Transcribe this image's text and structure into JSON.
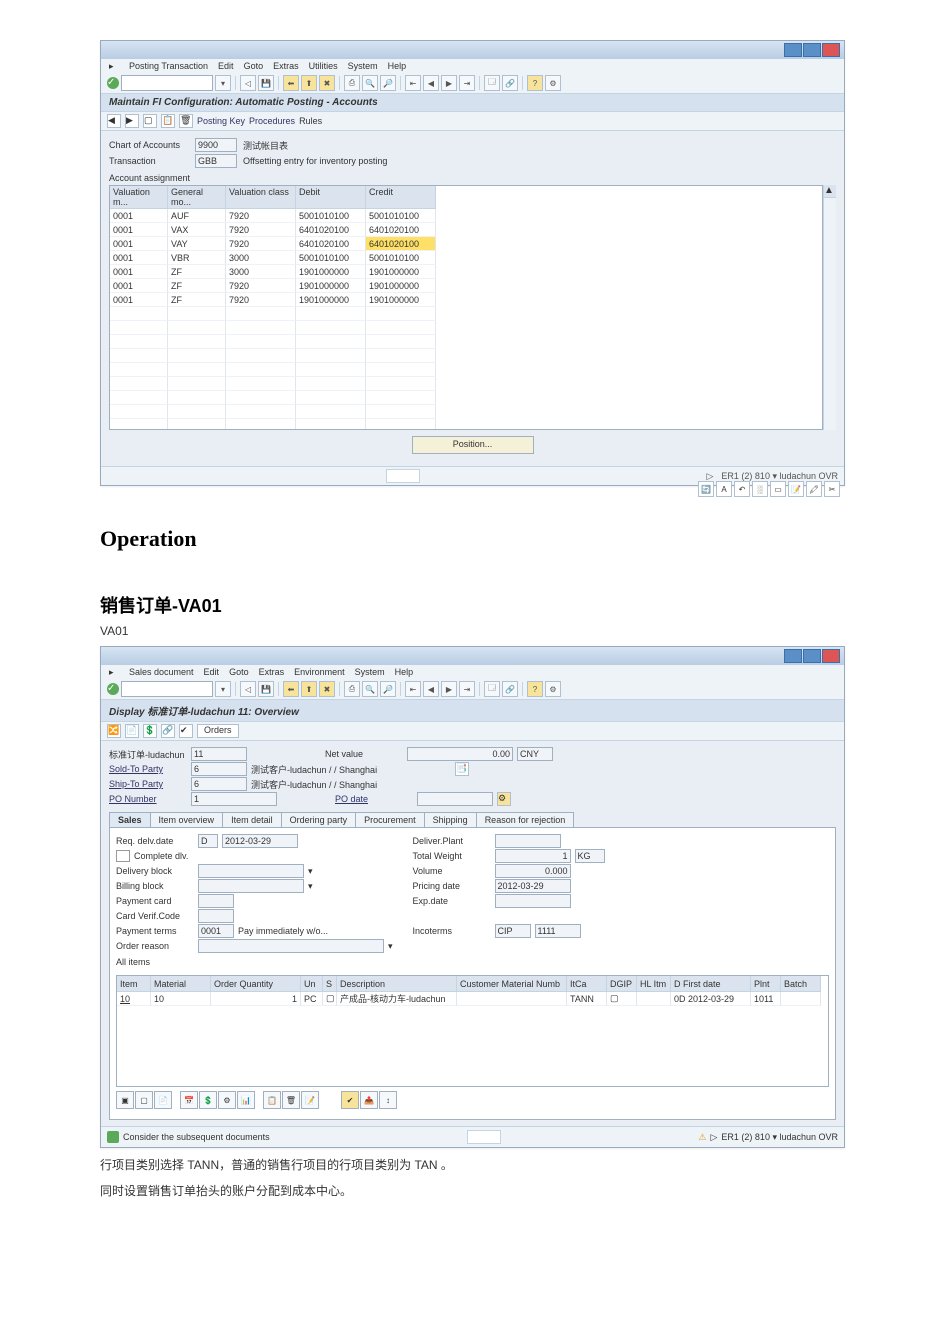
{
  "screen1": {
    "menus": [
      "Posting Transaction",
      "Edit",
      "Goto",
      "Extras",
      "Utilities",
      "System",
      "Help"
    ],
    "title": "Maintain FI Configuration: Automatic Posting - Accounts",
    "subtoolbar": {
      "posting_key": "Posting Key",
      "procedures": "Procedures",
      "rules": "Rules"
    },
    "chart_label": "Chart of Accounts",
    "chart_code": "9900",
    "chart_desc": "测试帐目表",
    "trans_label": "Transaction",
    "trans_code": "GBB",
    "trans_desc": "Offsetting entry for inventory posting",
    "account_assign": "Account assignment",
    "cols": {
      "vm": "Valuation m...",
      "gm": "General mo...",
      "vc": "Valuation class",
      "debit": "Debit",
      "credit": "Credit"
    },
    "rows": [
      {
        "vm": "0001",
        "gm": "AUF",
        "vc": "7920",
        "debit": "5001010100",
        "credit": "5001010100"
      },
      {
        "vm": "0001",
        "gm": "VAX",
        "vc": "7920",
        "debit": "6401020100",
        "credit": "6401020100"
      },
      {
        "vm": "0001",
        "gm": "VAY",
        "vc": "7920",
        "debit": "6401020100",
        "credit": "6401020100",
        "hl": true
      },
      {
        "vm": "0001",
        "gm": "VBR",
        "vc": "3000",
        "debit": "5001010100",
        "credit": "5001010100"
      },
      {
        "vm": "0001",
        "gm": "ZF",
        "vc": "3000",
        "debit": "1901000000",
        "credit": "1901000000"
      },
      {
        "vm": "0001",
        "gm": "ZF",
        "vc": "7920",
        "debit": "1901000000",
        "credit": "1901000000"
      },
      {
        "vm": "0001",
        "gm": "ZF",
        "vc": "7920",
        "debit": "1901000000",
        "credit": "1901000000"
      }
    ],
    "position_btn": "Position...",
    "status_right": "ER1 (2) 810 ▾  ludachun  OVR"
  },
  "headings": {
    "operation": "Operation",
    "va01_section": "销售订单-VA01",
    "tcode": "VA01"
  },
  "screen2": {
    "menus": [
      "Sales document",
      "Edit",
      "Goto",
      "Extras",
      "Environment",
      "System",
      "Help"
    ],
    "title": "Display 标准订单-ludachun 11: Overview",
    "orders_btn": "Orders",
    "hdr": {
      "order_label": "标准订单-ludachun",
      "order": "11",
      "netval_label": "Net value",
      "netval": "0.00",
      "curr": "CNY",
      "soldto_label": "Sold-To Party",
      "soldto": "6",
      "soldto_desc": "测试客户-ludachun / / Shanghai",
      "shipto_label": "Ship-To Party",
      "shipto": "6",
      "shipto_desc": "测试客户-ludachun / / Shanghai",
      "po_label": "PO Number",
      "po": "1",
      "podate_label": "PO date"
    },
    "tabs": [
      "Sales",
      "Item overview",
      "Item detail",
      "Ordering party",
      "Procurement",
      "Shipping",
      "Reason for rejection"
    ],
    "active_tab": 0,
    "sales_block": {
      "reqdel_label": "Req. delv.date",
      "reqdel_d": "D",
      "reqdel": "2012-03-29",
      "complete_label": "Complete dlv.",
      "delblk_label": "Delivery block",
      "billblk_label": "Billing block",
      "paycard_label": "Payment card",
      "cvcode_label": "Card Verif.Code",
      "payterm_label": "Payment terms",
      "payterm": "0001",
      "payterm_desc": "Pay immediately w/o...",
      "ordreason_label": "Order reason",
      "delplant_label": "Deliver.Plant",
      "totwgt_label": "Total Weight",
      "totwgt": "1",
      "totwgt_u": "KG",
      "vol_label": "Volume",
      "vol": "0.000",
      "prdate_label": "Pricing date",
      "prdate": "2012-03-29",
      "expdate_label": "Exp.date",
      "incoterm_label": "Incoterms",
      "incoterm": "CIP",
      "incoterm2": "1111"
    },
    "all_items": "All items",
    "item_cols": {
      "item": "Item",
      "material": "Material",
      "qty": "Order Quantity",
      "un": "Un",
      "s": "S",
      "desc": "Description",
      "cmn": "Customer Material Numb",
      "itca": "ItCa",
      "dgp": "DGIP",
      "hl": "HL Itm",
      "dfd": "D First date",
      "pln": "Plnt",
      "batch": "Batch"
    },
    "items": [
      {
        "item": "10",
        "material": "10",
        "qty": "1",
        "un": "PC",
        "s": "",
        "desc": "产成品-核动力车-ludachun",
        "cmn": "",
        "itca": "TANN",
        "dgp": "",
        "hl": "",
        "dfd": "0D 2012-03-29",
        "pln": "1011",
        "batch": ""
      }
    ],
    "msg": "Consider the subsequent documents",
    "status_right": "ER1 (2) 810 ▾  ludachun  OVR"
  },
  "notes": [
    "行项目类别选择 TANN，普通的销售行项目的行项目类别为 TAN 。",
    "同时设置销售订单抬头的账户分配到成本中心。"
  ]
}
